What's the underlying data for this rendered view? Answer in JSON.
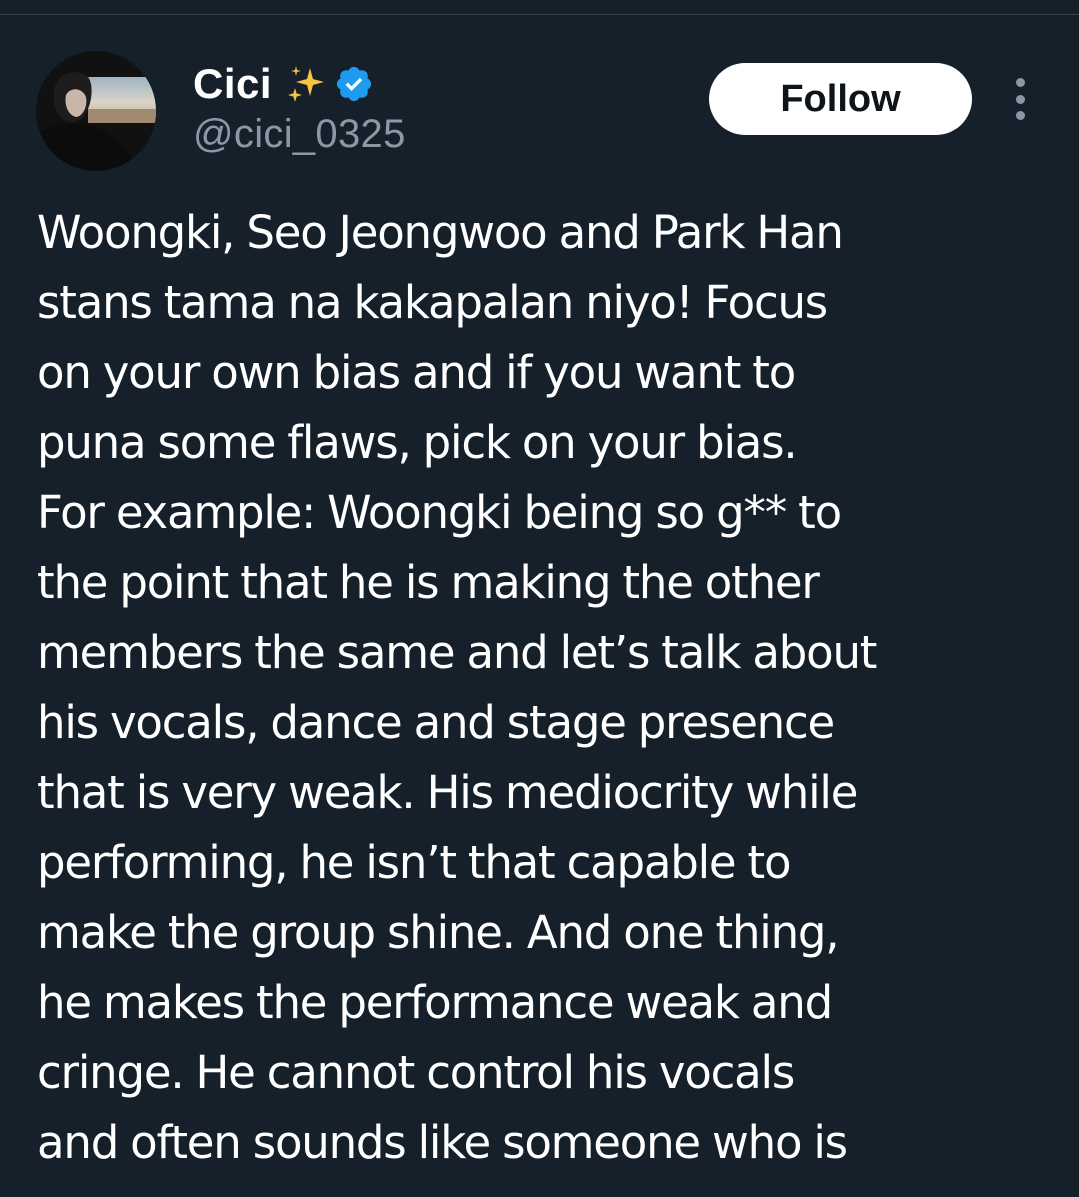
{
  "user": {
    "display_name": "Cici",
    "sparkle_emoji": "✨",
    "handle": "@cici_0325",
    "verified_icon": "verified-badge-icon",
    "verified_color": "#1d9bf0"
  },
  "actions": {
    "follow_label": "Follow",
    "more_icon": "more-vertical-icon"
  },
  "tweet": {
    "lines": [
      "Woongki, Seo Jeongwoo and Park Han",
      "stans tama na kakapalan niyo! Focus",
      "on your own bias and if you want to",
      "puna some flaws, pick on your bias.",
      "For example: Woongki being so g** to",
      "the point that he is making the other",
      "members the same and let’s talk about",
      "his vocals, dance and stage presence",
      "that is very weak. His mediocrity while",
      "performing, he isn’t that capable to",
      "make the group shine. And one thing,",
      "he makes the performance weak and",
      "cringe. He cannot control his vocals",
      "and often sounds like someone who is"
    ]
  },
  "colors": {
    "background": "#15202b",
    "text": "#ffffff",
    "secondary_text": "#8b98a5",
    "follow_bg": "#ffffff"
  }
}
